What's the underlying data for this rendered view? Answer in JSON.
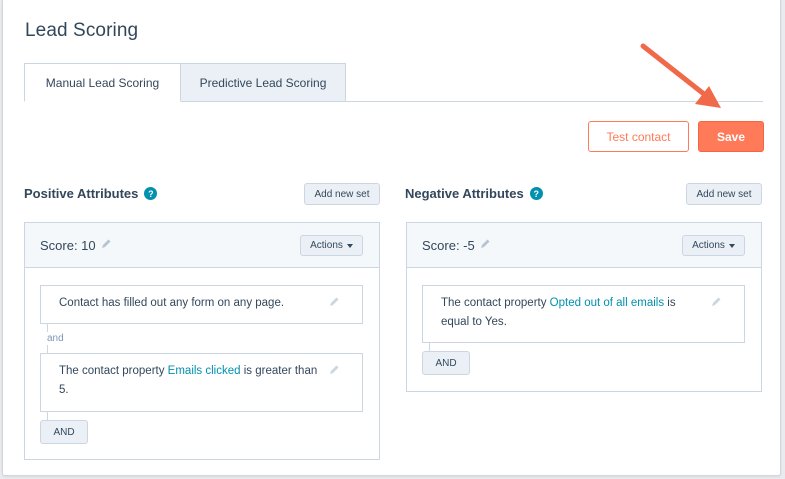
{
  "page": {
    "title": "Lead Scoring"
  },
  "tabs": [
    {
      "label": "Manual Lead Scoring",
      "active": true
    },
    {
      "label": "Predictive Lead Scoring",
      "active": false
    }
  ],
  "toolbar": {
    "test_contact_label": "Test contact",
    "save_label": "Save"
  },
  "positive": {
    "title": "Positive Attributes",
    "help": "?",
    "add_set_label": "Add new set",
    "score_label": "Score: 10",
    "actions_label": "Actions",
    "rules": [
      {
        "pre": "Contact has filled out ",
        "b1": "any form",
        "mid": " on ",
        "b2": "any page",
        "post": "."
      },
      {
        "pre": "The contact property ",
        "link": "Emails clicked",
        "mid": " is greater than",
        "value": "5",
        "post": "."
      }
    ],
    "and_connector": "and",
    "and_button": "AND"
  },
  "negative": {
    "title": "Negative Attributes",
    "help": "?",
    "add_set_label": "Add new set",
    "score_label": "Score: -5",
    "actions_label": "Actions",
    "rules": [
      {
        "pre": "The contact property ",
        "link": "Opted out of all emails",
        "mid": " is",
        "line2": "equal to ",
        "value": "Yes",
        "post": "."
      }
    ],
    "and_button": "AND"
  },
  "colors": {
    "accent": "#ff7a59",
    "link": "#0091ae",
    "text": "#33475b"
  },
  "icons": [
    "help-icon",
    "pencil-icon",
    "caret-down-icon",
    "arrow-annotation"
  ]
}
